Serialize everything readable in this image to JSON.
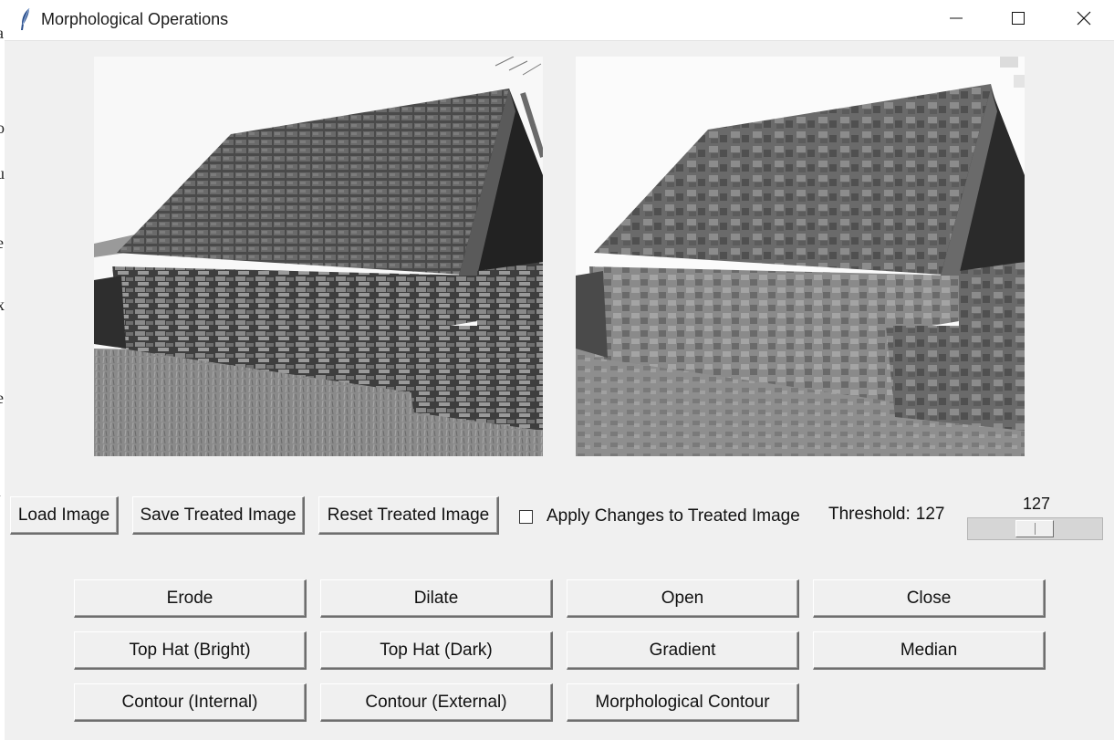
{
  "window": {
    "title": "Morphological Operations",
    "controls": [
      "minimize",
      "maximize",
      "close"
    ]
  },
  "images": {
    "original_icon": "original-image",
    "treated_icon": "treated-image"
  },
  "toolbar": {
    "load_label": "Load Image",
    "save_label": "Save Treated Image",
    "reset_label": "Reset Treated Image",
    "apply_changes_label": "Apply Changes to Treated Image",
    "apply_changes_checked": false,
    "threshold_label": "Threshold:",
    "threshold_value": "127",
    "slider_value": "127",
    "slider_level": 0.498
  },
  "operations": [
    [
      "Erode",
      "Dilate",
      "Open",
      "Close"
    ],
    [
      "Top Hat (Bright)",
      "Top Hat (Dark)",
      "Gradient",
      "Median"
    ],
    [
      "Contour (Internal)",
      "Contour (External)",
      "Morphological Contour"
    ]
  ],
  "colors": {
    "window_bg": "#f0f0f0",
    "titlebar_bg": "#ffffff"
  }
}
